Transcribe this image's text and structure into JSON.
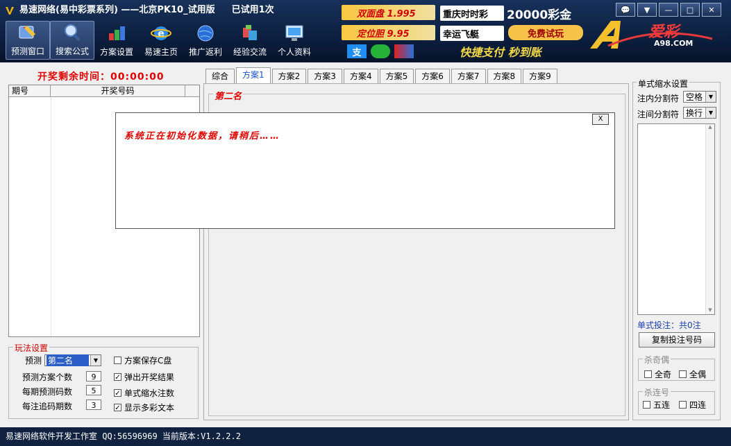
{
  "window": {
    "title": "易速网络(易中彩票系列) ——北京PK10_试用版",
    "trial_text": "已试用1次",
    "controls": [
      "💬",
      "▼",
      "—",
      "□",
      "✕"
    ]
  },
  "toolbar": {
    "items": [
      {
        "label": "预测窗口",
        "icon": "predict-window-icon"
      },
      {
        "label": "搜索公式",
        "icon": "search-formula-icon"
      },
      {
        "label": "方案设置",
        "icon": "plan-settings-icon"
      },
      {
        "label": "易速主页",
        "icon": "ie-home-icon"
      },
      {
        "label": "推广返利",
        "icon": "globe-rebate-icon"
      },
      {
        "label": "经验交流",
        "icon": "exchange-icon"
      },
      {
        "label": "个人资料",
        "icon": "monitor-profile-icon"
      }
    ]
  },
  "banner": {
    "ad1": "双面盘 1.995",
    "ad2": "重庆时时彩",
    "ad3": "20000彩金",
    "ad4": "定位胆 9.95",
    "ad5": "幸运飞艇",
    "ad6": "免费试玩",
    "ad7": "快捷支付 秒到账",
    "logo_text": "爱彩",
    "logo_domain": "A98.COM"
  },
  "countdown": {
    "label": "开奖剩余时间：",
    "value": "00:00:00"
  },
  "history_table": {
    "col_period": "期号",
    "col_numbers": "开奖号码"
  },
  "play_settings": {
    "title": "玩法设置",
    "predict_label": "预测",
    "predict_value": "第二名",
    "plan_count_label": "预测方案个数",
    "plan_count": "9",
    "per_period_label": "每期预测码数",
    "per_period": "5",
    "chase_label": "每注追码期数",
    "chase": "3",
    "checks": [
      {
        "label": "方案保存C盘",
        "checked": false
      },
      {
        "label": "弹出开奖结果",
        "checked": true
      },
      {
        "label": "单式缩水注数",
        "checked": true
      },
      {
        "label": "显示多彩文本",
        "checked": true
      }
    ]
  },
  "tabs": [
    "综合",
    "方案1",
    "方案2",
    "方案3",
    "方案4",
    "方案5",
    "方案6",
    "方案7",
    "方案8",
    "方案9"
  ],
  "main": {
    "group_title": "第二名",
    "popup_message": "系统正在初始化数据，请稍后……",
    "popup_close": "X"
  },
  "right_panel": {
    "title": "单式缩水设置",
    "inner_sep_label": "注内分割符",
    "inner_sep_value": "空格",
    "outer_sep_label": "注间分割符",
    "outer_sep_value": "换行",
    "bet_count": "单式投注：共0注",
    "copy_button": "复制投注号码",
    "odd_even_title": "杀奇偶",
    "all_odd": "全奇",
    "all_even": "全偶",
    "consecutive_title": "杀连号",
    "five_consec": "五连",
    "four_consec": "四连"
  },
  "status": {
    "text": "易速网络软件开发工作室 QQ:56596969  当前版本:V1.2.2.2"
  },
  "colors": {
    "header": "#0c1f3f",
    "accent_red": "#e00000",
    "tab_active": "#1a55c8"
  }
}
